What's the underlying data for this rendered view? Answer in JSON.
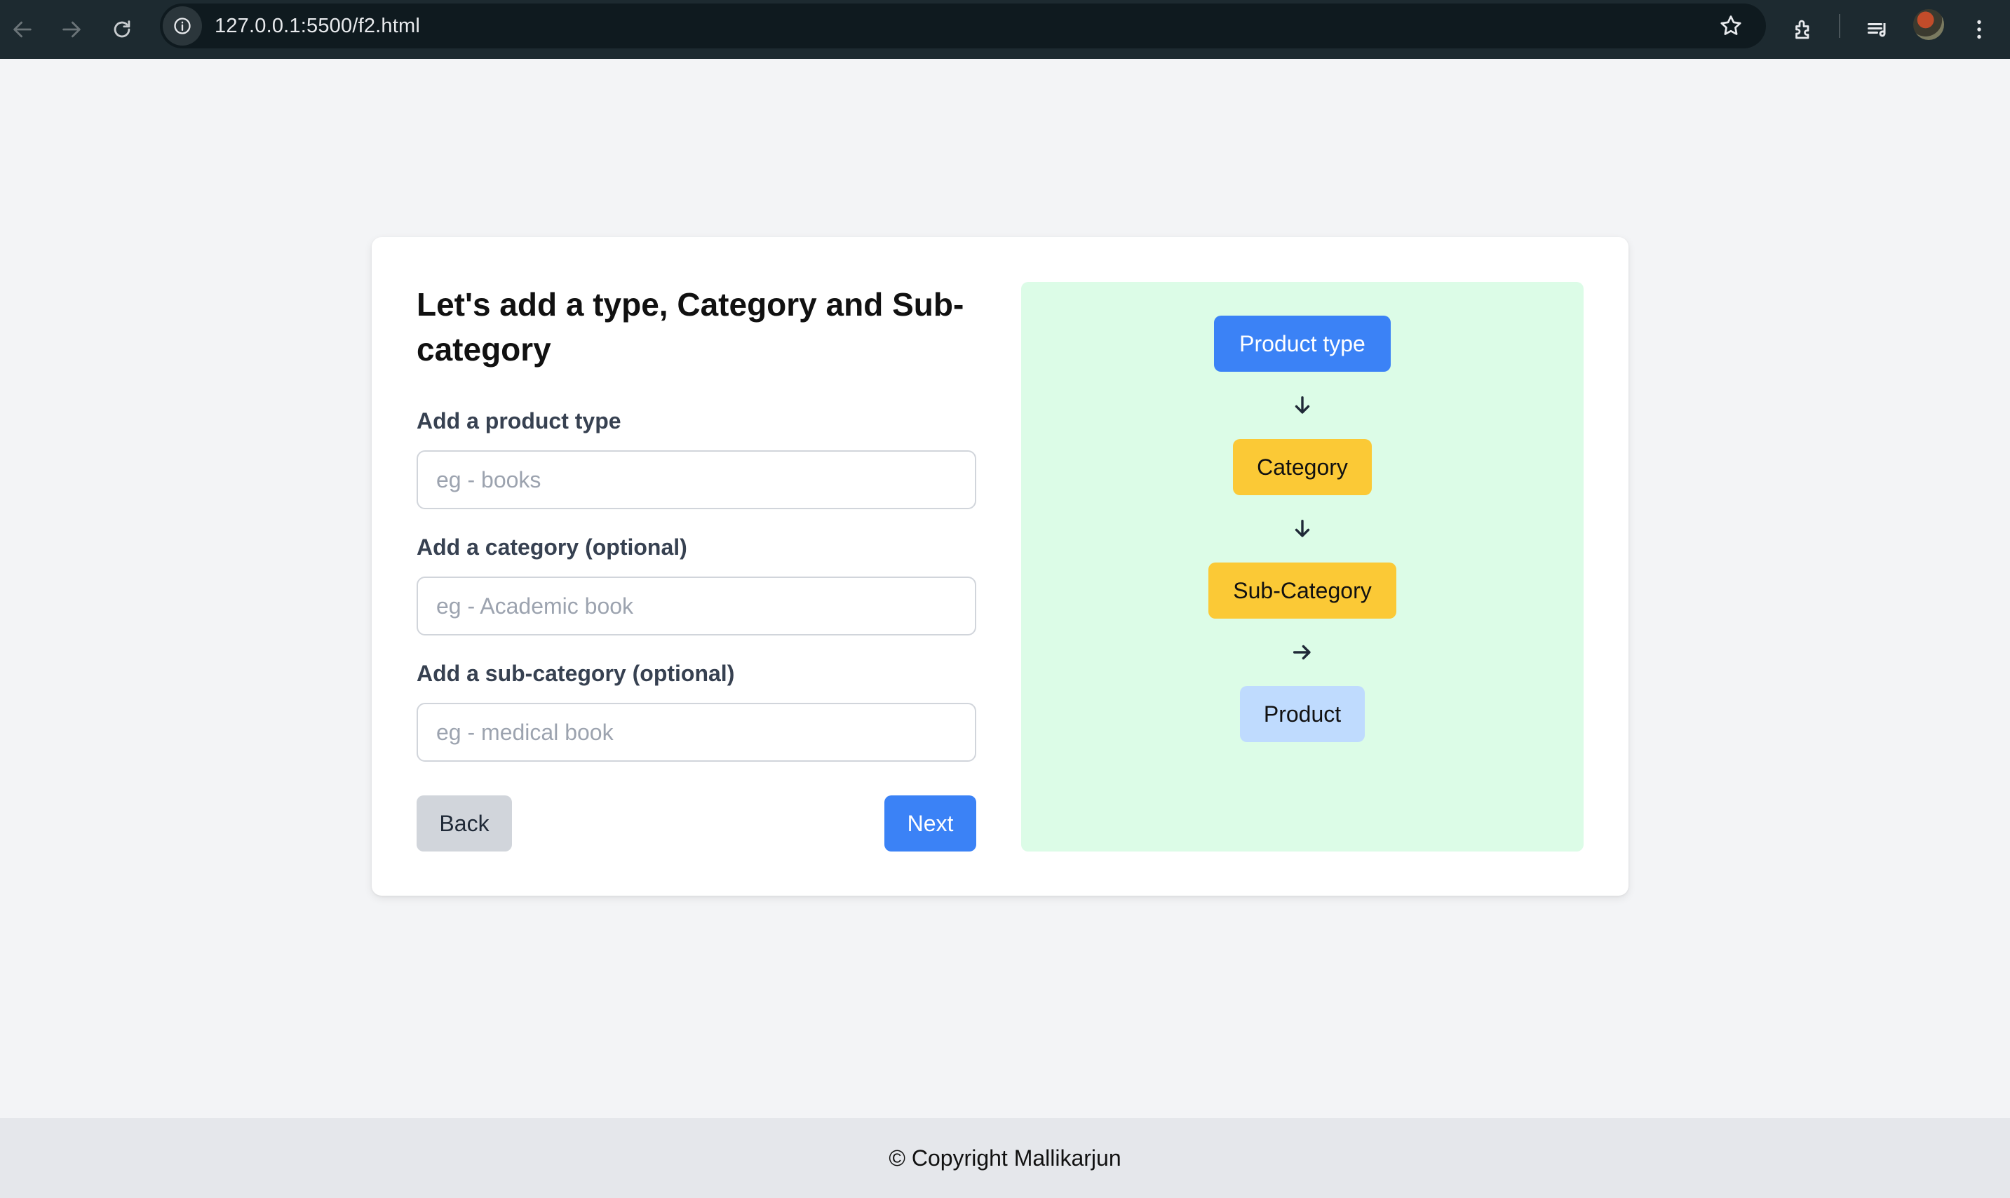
{
  "browser": {
    "url": "127.0.0.1:5500/f2.html",
    "icons": [
      "back-arrow-icon",
      "forward-arrow-icon",
      "reload-icon",
      "site-info-icon",
      "bookmark-star-icon",
      "extensions-icon",
      "media-queue-icon",
      "profile-avatar",
      "more-menu-icon"
    ]
  },
  "form": {
    "title": "Let's add a type, Category and Sub-category",
    "fields": [
      {
        "label": "Add a product type",
        "placeholder": "eg - books",
        "value": ""
      },
      {
        "label": "Add a category (optional)",
        "placeholder": "eg - Academic book",
        "value": ""
      },
      {
        "label": "Add a sub-category (optional)",
        "placeholder": "eg - medical book",
        "value": ""
      }
    ],
    "back_label": "Back",
    "next_label": "Next"
  },
  "flow": {
    "nodes": [
      {
        "label": "Product type",
        "color": "#3b82f6"
      },
      {
        "label": "Category",
        "color": "#fbc936"
      },
      {
        "label": "Sub-Category",
        "color": "#fbc936"
      },
      {
        "label": "Product",
        "color": "#bfdbfe"
      }
    ],
    "arrows": [
      "arrow-down-icon",
      "arrow-down-icon",
      "arrow-right-icon"
    ],
    "panel_color": "#dcfce7"
  },
  "footer": {
    "text": "© Copyright Mallikarjun"
  }
}
